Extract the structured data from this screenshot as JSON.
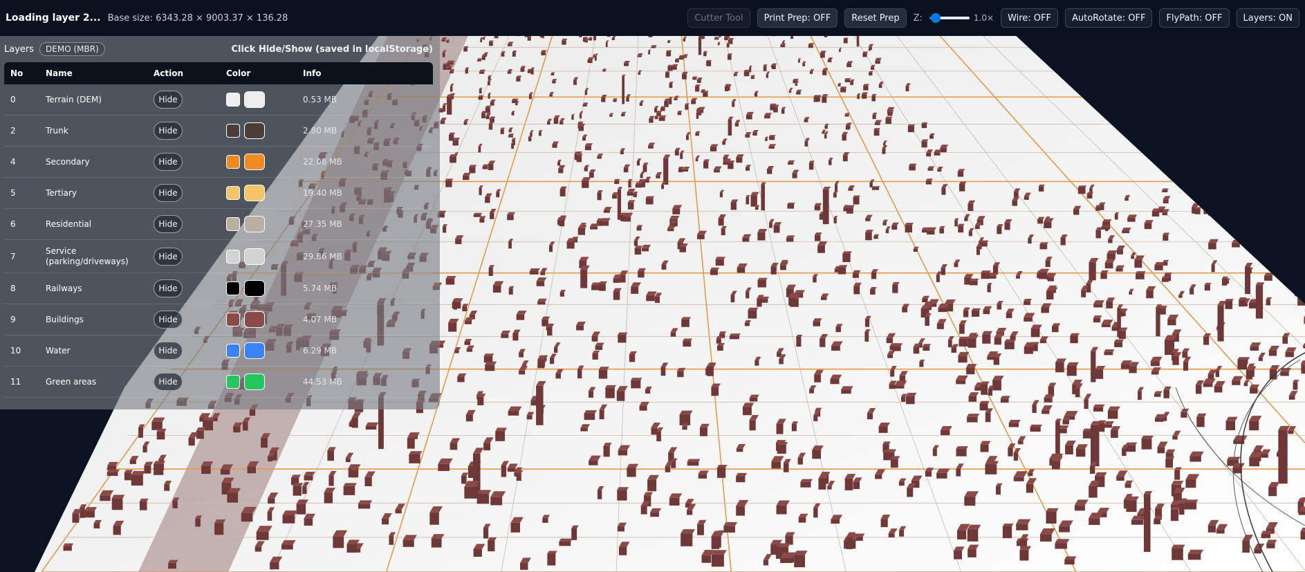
{
  "topbar": {
    "status": "Loading layer 2...",
    "base_size": "Base size: 6343.28 × 9003.37 × 136.28",
    "buttons": {
      "cutter": "Cutter Tool",
      "print_prep": "Print Prep: OFF",
      "reset_prep": "Reset Prep",
      "wire": "Wire: OFF",
      "autorotate": "AutoRotate: OFF",
      "flypath": "FlyPath: OFF",
      "layers": "Layers: ON"
    },
    "z_label": "Z:",
    "z_value": "1.0×",
    "z_level": 0.05
  },
  "panel": {
    "title": "Layers",
    "badge": "DEMO (MBR)",
    "hint": "Click Hide/Show (saved in localStorage)",
    "headers": {
      "no": "No",
      "name": "Name",
      "action": "Action",
      "color": "Color",
      "info": "Info"
    },
    "hide_label": "Hide",
    "rows": [
      {
        "no": "0",
        "name": "Terrain (DEM)",
        "color": "#eeeeee",
        "info": "0.53 MB"
      },
      {
        "no": "2",
        "name": "Trunk",
        "color": "#4a3d3a",
        "info": "2.80 MB"
      },
      {
        "no": "4",
        "name": "Secondary",
        "color": "#ef8a24",
        "info": "22.06 MB"
      },
      {
        "no": "5",
        "name": "Tertiary",
        "color": "#f5c36a",
        "info": "19.40 MB"
      },
      {
        "no": "6",
        "name": "Residential",
        "color": "#b8afa0",
        "info": "27.35 MB"
      },
      {
        "no": "7",
        "name": "Service (parking/driveways)",
        "color": "#d2d2d2",
        "info": "29.86 MB"
      },
      {
        "no": "8",
        "name": "Railways",
        "color": "#000000",
        "info": "5.74 MB"
      },
      {
        "no": "9",
        "name": "Buildings",
        "color": "#8b4a47",
        "info": "4.07 MB"
      },
      {
        "no": "10",
        "name": "Water",
        "color": "#3b82f6",
        "info": "6.29 MB"
      },
      {
        "no": "11",
        "name": "Green areas",
        "color": "#22c55e",
        "info": "44.53 MB"
      }
    ]
  },
  "colors": {
    "background": "#0b1322",
    "map": "#f2f2f2",
    "building": "#6e3838",
    "road": "#e39a4a",
    "accent": "#0b78e3"
  }
}
